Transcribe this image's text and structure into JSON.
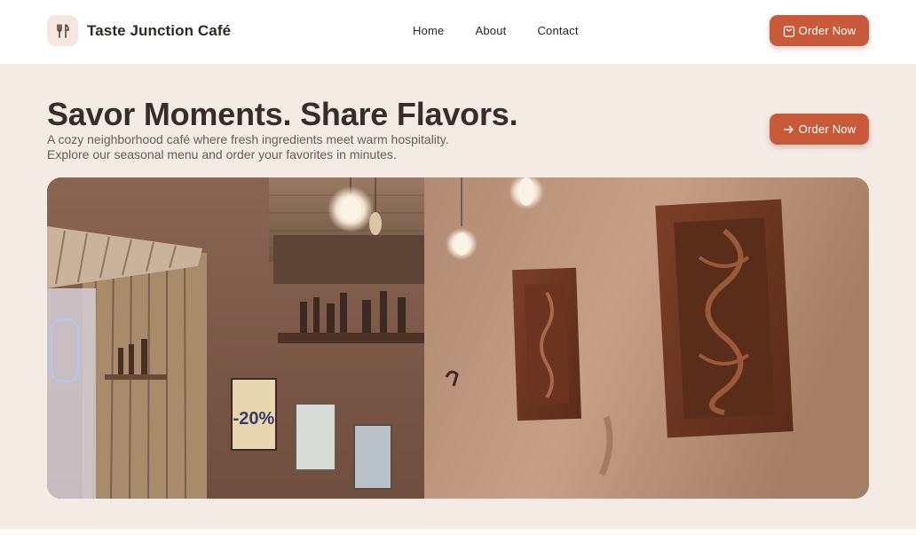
{
  "header": {
    "brand_name": "Taste Junction Café",
    "brand_icon": "utensils-icon",
    "nav": [
      "Home",
      "About",
      "Contact"
    ],
    "order_button": {
      "label": "Order Now",
      "icon": "shopping-bag-icon"
    }
  },
  "hero": {
    "title": "Savor Moments. Share Flavors.",
    "subtitle_line1": "A cozy neighborhood café where fresh ingredients meet warm hospitality.",
    "subtitle_line2": "Explore our seasonal menu and order your favorites in minutes.",
    "order_button": {
      "label": "Order Now",
      "icon": "arrow-right-icon"
    },
    "image": {
      "description": "cafe interior photo",
      "poster_text": "-20%"
    }
  },
  "colors": {
    "accent": "#c85a3a",
    "background": "#f5ebe5",
    "text": "#3a2c2a"
  }
}
